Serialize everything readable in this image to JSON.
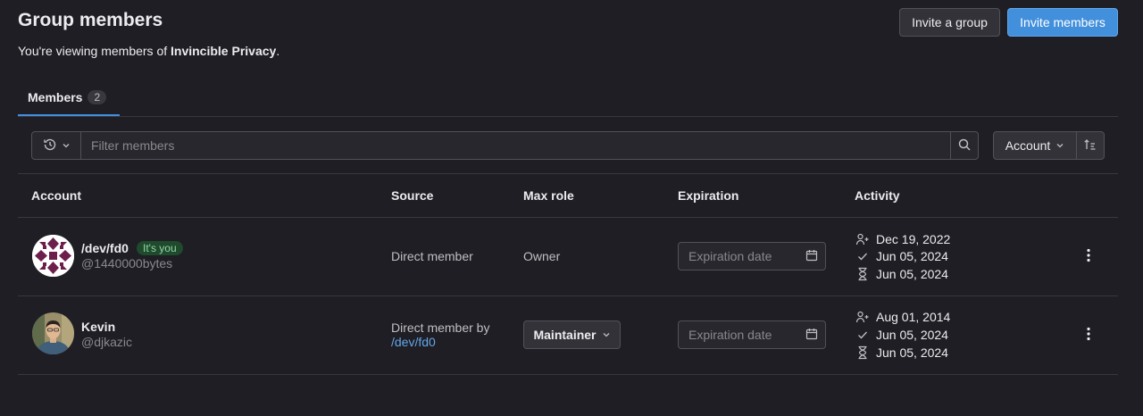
{
  "header": {
    "title": "Group members",
    "subtitle_prefix": "You're viewing members of ",
    "group_name": "Invincible Privacy",
    "subtitle_suffix": ".",
    "invite_group_label": "Invite a group",
    "invite_members_label": "Invite members"
  },
  "tabs": [
    {
      "label": "Members",
      "count": "2"
    }
  ],
  "filter": {
    "placeholder": "Filter members",
    "history_icon": "history-icon",
    "search_icon": "search-icon"
  },
  "sort": {
    "field": "Account",
    "direction_icon": "sort-lowest-icon"
  },
  "table": {
    "headers": {
      "account": "Account",
      "source": "Source",
      "max_role": "Max role",
      "expiration": "Expiration",
      "activity": "Activity"
    },
    "rows": [
      {
        "name": "/dev/fd0",
        "badge": "It's you",
        "username": "@1440000bytes",
        "source": "Direct member",
        "source_link": "",
        "role": "Owner",
        "expiration_placeholder": "Expiration date",
        "activity": {
          "joined": "Dec 19, 2022",
          "last_activity": "Jun 05, 2024",
          "access_granted": "Jun 05, 2024"
        }
      },
      {
        "name": "Kevin",
        "badge": "",
        "username": "@djkazic",
        "source": "Direct member by",
        "source_link": "/dev/fd0",
        "role": "Maintainer",
        "expiration_placeholder": "Expiration date",
        "activity": {
          "joined": "Aug 01, 2014",
          "last_activity": "Jun 05, 2024",
          "access_granted": "Jun 05, 2024"
        }
      }
    ]
  },
  "colors": {
    "background": "#1f1e24",
    "primary": "#428fdc",
    "link": "#63a6e9",
    "success_badge": "#1f4a2c"
  }
}
